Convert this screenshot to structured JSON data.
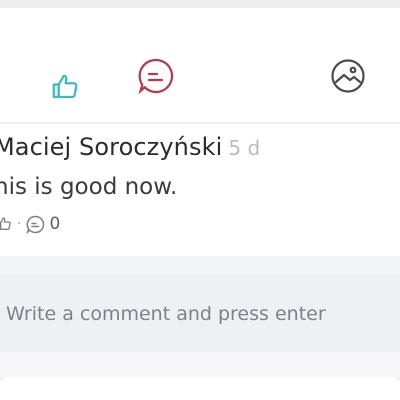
{
  "actions": {
    "like_icon": "thumbs-up-icon",
    "comment_icon": "comment-icon",
    "photo_icon": "add-photo-icon",
    "like_color": "#3fb8c4",
    "comment_color": "#b23a4a",
    "photo_color": "#4a4a52"
  },
  "comment": {
    "author": "Maciej Soroczyński",
    "timestamp": "5 d",
    "text": "his is good now.",
    "separator": "·",
    "reply_count": "0"
  },
  "composer": {
    "placeholder": "Write a comment and press enter"
  }
}
